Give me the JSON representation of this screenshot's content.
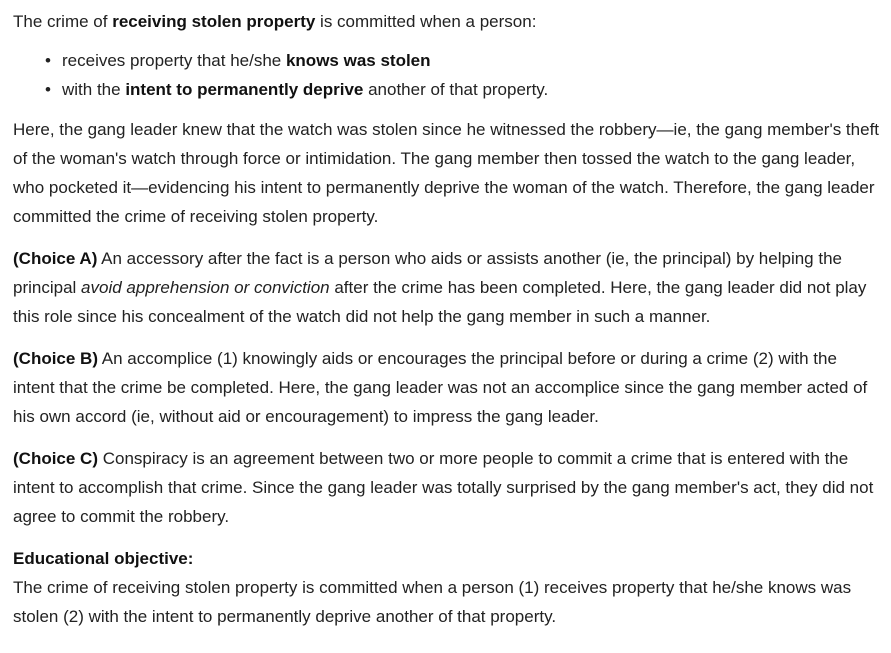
{
  "intro": {
    "pre": "The crime of ",
    "bold": "receiving stolen property",
    "post": " is committed when a person:"
  },
  "bullets": [
    {
      "pre": "receives property that he/she ",
      "bold": "knows was stolen",
      "post": ""
    },
    {
      "pre": "with the ",
      "bold": "intent to permanently deprive",
      "post": " another of that property."
    }
  ],
  "explanation": "Here, the gang leader knew that the watch was stolen since he witnessed the robbery—ie, the gang member's theft of the woman's watch through force or intimidation.  The gang member then tossed the watch to the gang leader, who pocketed it—evidencing his intent to permanently deprive the woman of the watch.  Therefore, the gang leader committed the crime of receiving stolen property.",
  "choices": [
    {
      "label": "(Choice A)",
      "pre": "  An accessory after the fact is a person who aids or assists another (ie, the principal) by helping the principal ",
      "italic": "avoid apprehension or conviction",
      "post": " after the crime has been completed.  Here, the gang leader did not play this role since his concealment of the watch did not help the gang member in such a manner."
    },
    {
      "label": "(Choice B)",
      "pre": "  An accomplice (1) knowingly aids or encourages the principal before or during a crime (2) with the intent that the crime be completed.  Here, the gang leader was not an accomplice since the gang member acted of his own accord (ie, without aid or encouragement) to impress the gang leader.",
      "italic": "",
      "post": ""
    },
    {
      "label": "(Choice C)",
      "pre": "  Conspiracy is an agreement between two or more people to commit a crime that is entered with the intent to accomplish that crime.  Since the gang leader was totally surprised by the gang member's act, they did not agree to commit the robbery.",
      "italic": "",
      "post": ""
    }
  ],
  "objective": {
    "title": "Educational objective:",
    "text": "The crime of receiving stolen property is committed when a person (1) receives property that he/she knows was stolen (2) with the intent to permanently deprive another of that property."
  }
}
